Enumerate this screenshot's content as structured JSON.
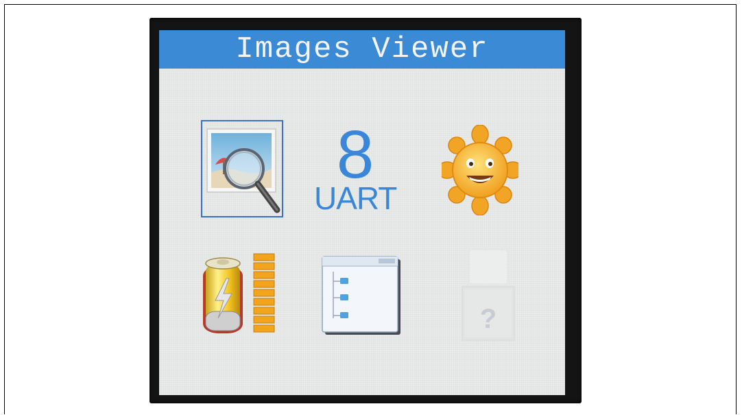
{
  "screen": {
    "title": "Images Viewer",
    "accent_color": "#3a8ad6"
  },
  "icons": [
    {
      "name": "image-viewer",
      "icon": "magnifier-over-picture-icon"
    },
    {
      "name": "uart",
      "number": "8",
      "label": "UART"
    },
    {
      "name": "settings",
      "icon": "sun-smiley-icon"
    },
    {
      "name": "battery",
      "icon": "battery-level-icon"
    },
    {
      "name": "file-browser",
      "icon": "folder-tree-window-icon"
    },
    {
      "name": "help",
      "icon": "question-mark-icon"
    }
  ]
}
